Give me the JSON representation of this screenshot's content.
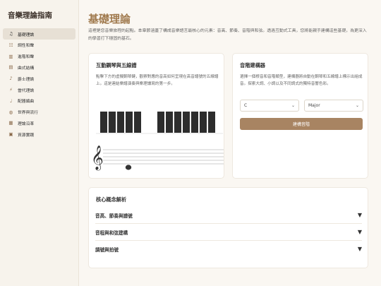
{
  "app": {
    "title": "音樂理論指南"
  },
  "sidebar": {
    "items": [
      {
        "label": "基礎理論",
        "icon": "music-note-icon",
        "glyph": "♫",
        "active": true
      },
      {
        "label": "調性和聲",
        "icon": "scale-icon",
        "glyph": "☷",
        "active": false
      },
      {
        "label": "進階和聲",
        "icon": "piano-icon",
        "glyph": "▥",
        "active": false
      },
      {
        "label": "曲式結構",
        "icon": "books-icon",
        "glyph": "▤",
        "active": false
      },
      {
        "label": "爵士理論",
        "icon": "trumpet-icon",
        "glyph": "♪",
        "active": false
      },
      {
        "label": "當代理論",
        "icon": "lightning-icon",
        "glyph": "⚡",
        "active": false
      },
      {
        "label": "配器編曲",
        "icon": "violin-icon",
        "glyph": "♩",
        "active": false
      },
      {
        "label": "世界與流行",
        "icon": "globe-icon",
        "glyph": "◍",
        "active": false
      },
      {
        "label": "理論沿革",
        "icon": "building-icon",
        "glyph": "▦",
        "active": false
      },
      {
        "label": "資源實踐",
        "icon": "book-stack-icon",
        "glyph": "▣",
        "active": false
      }
    ]
  },
  "main": {
    "title": "基礎理論",
    "description": "這裡是您音樂旅程的起點。本章節涵蓋了構成音樂語言最核心的元素：音高、節奏、音階與和弦。透過互動式工具，您將能親手建構這些基礎，為更深入的學習打下穩固的基石。"
  },
  "piano_card": {
    "title": "互動鋼琴與五線譜",
    "description": "點擊下方的虛擬鋼琴鍵，觀察對應的音高如何呈現在高音譜號的五線譜上。這是連結樂譜演奏與樂理讀寫的第一步。"
  },
  "scale_card": {
    "title": "音階建構器",
    "description": "選擇一個根音和音階類型，建構器將自動在鋼琴和五線譜上標示出組成音。探索大調、小調以及不同調式的獨特音響色彩。",
    "root_value": "C",
    "type_value": "Major",
    "build_label": "建構音階"
  },
  "concepts": {
    "title": "核心概念解析",
    "items": [
      {
        "label": "音高、節奏與譜號"
      },
      {
        "label": "音程與和弦建構"
      },
      {
        "label": "調號與拍號"
      }
    ]
  },
  "colors": {
    "accent": "#a07a4e",
    "button": "#a88462",
    "sidebar_bg": "#f7f3ec",
    "page_bg": "#faf7f2"
  }
}
